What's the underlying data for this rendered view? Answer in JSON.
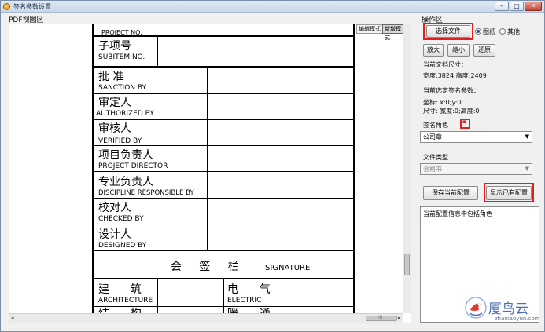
{
  "window": {
    "title": "签名参数设置",
    "min": "–",
    "max": "□",
    "close": "✕"
  },
  "pdf_panel": {
    "label": "PDF视图区",
    "modes": [
      "编辑模式",
      "新增模式"
    ],
    "scroll_left": "◂",
    "scroll_right": "▸",
    "scroll_grip": "III"
  },
  "document": {
    "top_cut": "PROJECT NO.",
    "subitem_cn": "子项号",
    "subitem_en": "SUBITEM NO.",
    "rows": [
      {
        "cn": "批  准",
        "en": "SANCTION BY"
      },
      {
        "cn": "审定人",
        "en": "AUTHORIZED BY"
      },
      {
        "cn": "审核人",
        "en": "VERIFIED BY"
      },
      {
        "cn": "项目负责人",
        "en": "PROJECT DIRECTOR"
      },
      {
        "cn": "专业负责人",
        "en": "DISCIPLINE RESPONSIBLE BY"
      },
      {
        "cn": "校对人",
        "en": "CHECKED BY"
      },
      {
        "cn": "设计人",
        "en": "DESIGNED BY"
      }
    ],
    "signature_cn": "会     签     栏",
    "signature_en": "SIGNATURE",
    "sig_rows": [
      {
        "left_cn": "建      筑",
        "left_en": "ARCHITECTURE",
        "right_cn": "电      气",
        "right_en": "ELECTRIC"
      },
      {
        "left_cn": "结      构",
        "left_en": "",
        "right_cn": "暖      通",
        "right_en": ""
      }
    ]
  },
  "ops_panel": {
    "label": "操作区",
    "select_file_button": "选择文件",
    "file_type_options": [
      "图纸",
      "其他"
    ],
    "selected_file_type": "图纸",
    "zoom_in": "放大",
    "zoom_out": "缩小",
    "reset": "还原",
    "doc_size_label": "当前文档尺寸：",
    "doc_size_value": "宽度:3824;高度:2409",
    "sign_params_label": "当前选定签名参数：",
    "coords": "坐标: x:0;y:0;",
    "size": "尺寸: 宽度:0;高度:0",
    "sign_role_label": "签名角色",
    "sign_role_value": "公司章",
    "file_type_label": "文件类型",
    "file_type_value": "合格书",
    "save_button": "保存当前配置",
    "show_button": "显示已有配置",
    "list_header": "当前配置信息中包括角色"
  },
  "watermark": {
    "text": "厦鸟云",
    "sub": "zhaniaoyun.com"
  },
  "colors": {
    "highlight": "#e21e1e",
    "title_bg": "#c9d8ec",
    "watermark": "#4a6fb3"
  }
}
